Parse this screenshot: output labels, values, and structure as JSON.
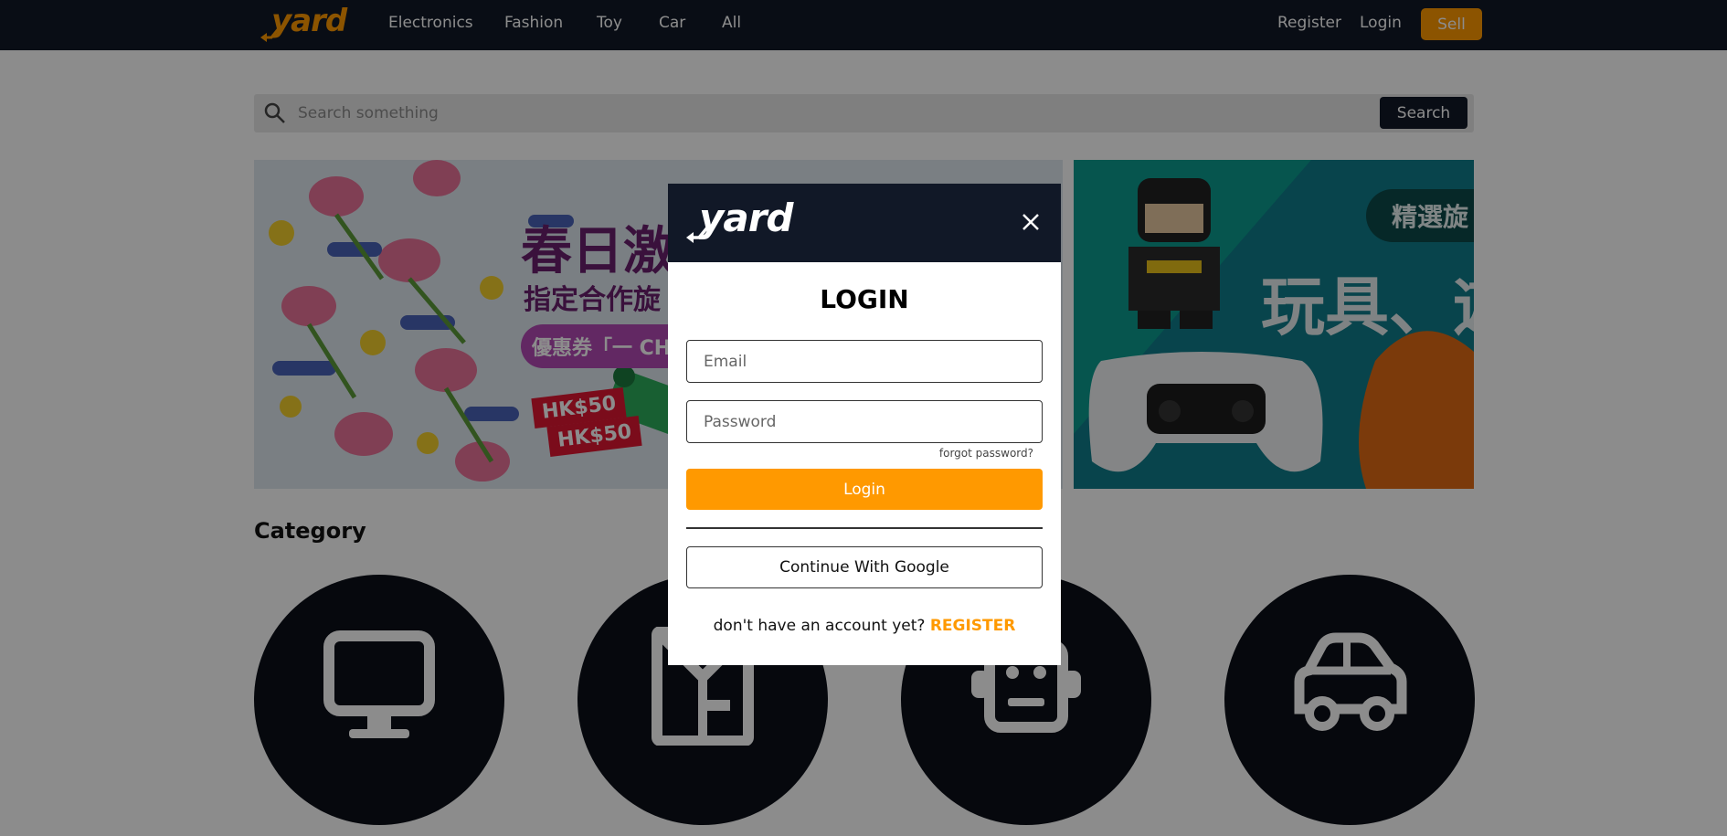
{
  "nav": {
    "logo_text": "yard",
    "links": [
      "Electronics",
      "Fashion",
      "Toy",
      "Car",
      "All"
    ],
    "register_label": "Register",
    "login_label": "Login",
    "sell_label": "Sell"
  },
  "search": {
    "placeholder": "Search something",
    "button_label": "Search"
  },
  "banners": {
    "banner1": {
      "headline": "春日激",
      "subline": "指定合作旋",
      "coupon": "優惠券「一 CH",
      "tag1": "HK$50",
      "tag2": "HK$50"
    },
    "banner2": {
      "pill": "精選旋",
      "title": "玩具、遊"
    }
  },
  "category": {
    "title": "Category",
    "items": [
      "computer-icon",
      "shirt-icon",
      "robot-icon",
      "car-icon"
    ]
  },
  "modal": {
    "logo_text": "yard",
    "title": "LOGIN",
    "email_placeholder": "Email",
    "password_placeholder": "Password",
    "forgot_label": "forgot password?",
    "login_label": "Login",
    "google_label": "Continue With Google",
    "register_prompt": "don't have an account yet?",
    "register_link": "REGISTER"
  },
  "colors": {
    "brand_orange": "#ff9900",
    "nav_dark": "#111827"
  }
}
